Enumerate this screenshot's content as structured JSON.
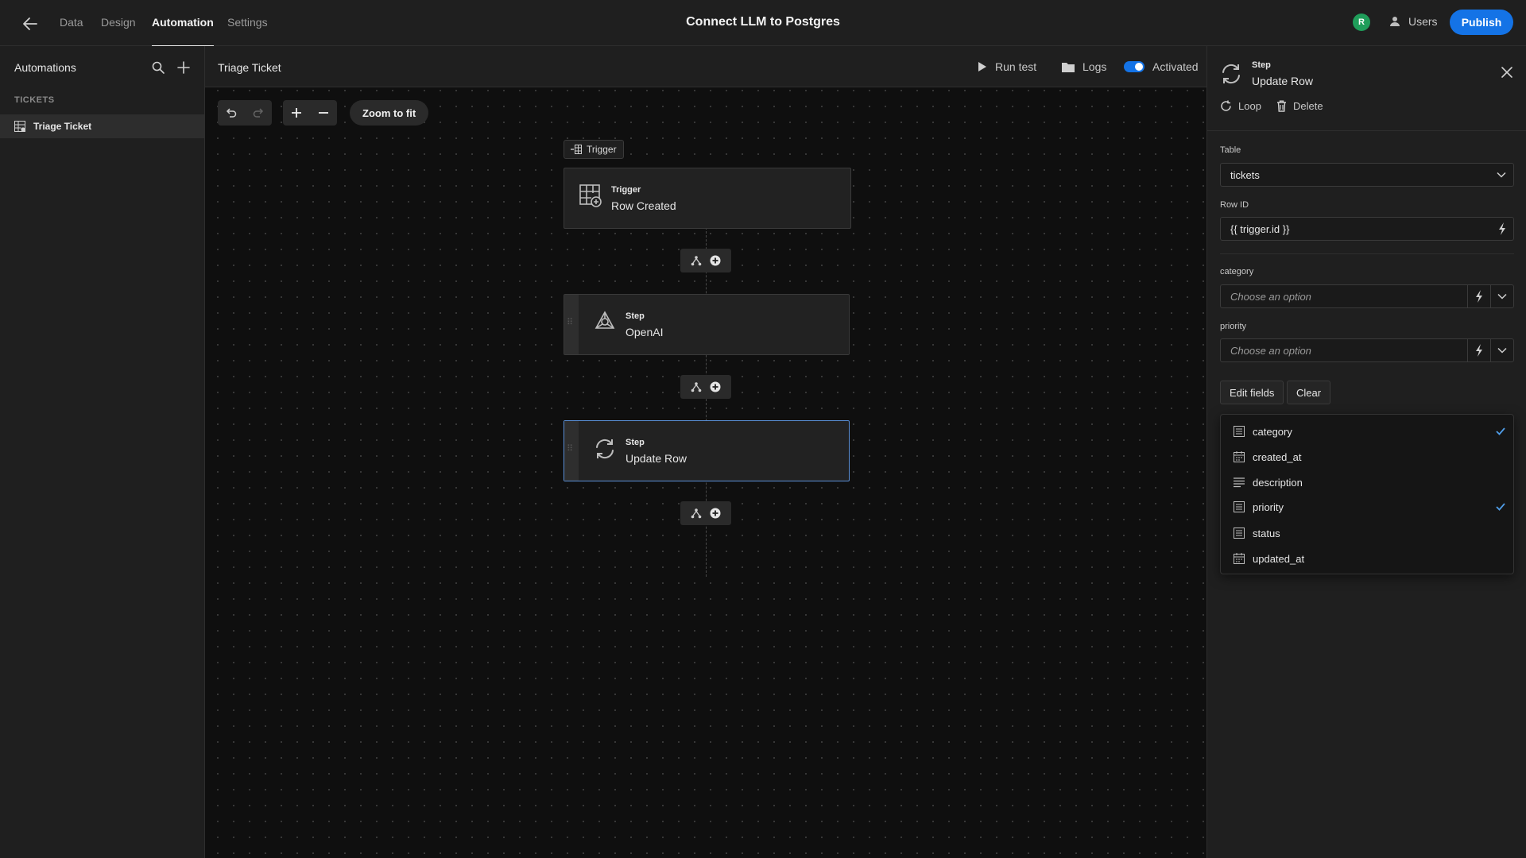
{
  "topbar": {
    "tabs": [
      {
        "label": "Data"
      },
      {
        "label": "Design"
      },
      {
        "label": "Automation"
      },
      {
        "label": "Settings"
      }
    ],
    "title": "Connect LLM to Postgres",
    "avatar_initial": "R",
    "users_label": "Users",
    "publish_label": "Publish"
  },
  "sidebar": {
    "title": "Automations",
    "section": "TICKETS",
    "items": [
      {
        "label": "Triage Ticket"
      }
    ]
  },
  "canvas": {
    "title": "Triage Ticket",
    "run_test_label": "Run test",
    "logs_label": "Logs",
    "activated_label": "Activated",
    "activated": true,
    "zoom_fit_label": "Zoom to fit",
    "trigger_tag": "Trigger",
    "nodes": [
      {
        "kind": "Trigger",
        "name": "Row Created",
        "icon": "table-add-icon"
      },
      {
        "kind": "Step",
        "name": "OpenAI",
        "icon": "openai-icon"
      },
      {
        "kind": "Step",
        "name": "Update Row",
        "icon": "refresh-icon",
        "selected": true
      }
    ]
  },
  "panel": {
    "kind": "Step",
    "name": "Update Row",
    "loop_label": "Loop",
    "delete_label": "Delete",
    "table": {
      "label": "Table",
      "value": "tickets"
    },
    "row_id": {
      "label": "Row ID",
      "value": "{{ trigger.id }}"
    },
    "category": {
      "label": "category",
      "placeholder": "Choose an option"
    },
    "priority": {
      "label": "priority",
      "placeholder": "Choose an option"
    },
    "edit_fields_label": "Edit fields",
    "clear_label": "Clear",
    "field_options": [
      {
        "label": "category",
        "icon": "text-field-icon",
        "checked": true
      },
      {
        "label": "created_at",
        "icon": "calendar-icon",
        "checked": false
      },
      {
        "label": "description",
        "icon": "paragraph-icon",
        "checked": false
      },
      {
        "label": "priority",
        "icon": "text-field-icon",
        "checked": true
      },
      {
        "label": "status",
        "icon": "text-field-icon",
        "checked": false
      },
      {
        "label": "updated_at",
        "icon": "calendar-icon",
        "checked": false
      }
    ]
  },
  "colors": {
    "accent": "#1473e6",
    "background": "#0f0f0f",
    "panel": "#1f1f1f",
    "check": "#4f9de8"
  }
}
